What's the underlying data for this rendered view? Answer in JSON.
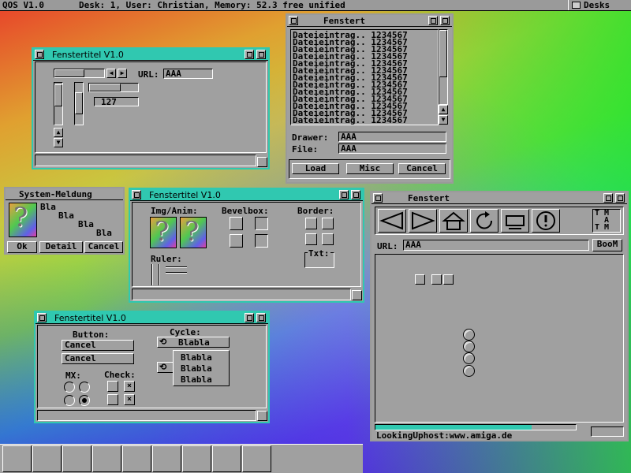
{
  "screen": {
    "title": "QOS V1.0",
    "status": "Desk: 1, User: Christian, Memory: 52.3 free unified",
    "desks_label": "Desks"
  },
  "win1": {
    "title": "Fenstertitel V1.0",
    "url_label": "URL:",
    "url_value": "AAA",
    "number_value": "127"
  },
  "filewin": {
    "title": "Fenstert",
    "entries": [
      "Dateieintrag.. 1234567",
      "Dateieintrag.. 1234567",
      "Dateieintrag.. 1234567",
      "Dateieintrag.. 1234567",
      "Dateieintrag.. 1234567",
      "Dateieintrag.. 1234567",
      "Dateieintrag.. 1234567",
      "Dateieintrag.. 1234567",
      "Dateieintrag.. 1234567",
      "Dateieintrag.. 1234567",
      "Dateieintrag.. 1234567",
      "Dateieintrag.. 1234567",
      "Dateieintrag.. 1234567"
    ],
    "drawer_label": "Drawer:",
    "drawer_value": "AAA",
    "file_label": "File:",
    "file_value": "AAA",
    "load": "Load",
    "misc": "Misc",
    "cancel": "Cancel"
  },
  "sysmsg": {
    "title": "System-Meldung",
    "lines": [
      "Bla",
      "Bla",
      "Bla",
      "Bla"
    ],
    "ok": "Ok",
    "detail": "Detail",
    "cancel": "Cancel"
  },
  "win2": {
    "title": "Fenstertitel V1.0",
    "img_label": "Img/Anim:",
    "bevel_label": "Bevelbox:",
    "border_label": "Border:",
    "ruler_label": "Ruler:",
    "txt_label": "Txt:"
  },
  "browser": {
    "title": "Fenstert",
    "tm": "T M\n  A\nT M",
    "url_label": "URL:",
    "url_value": "AAA",
    "boom": "BooM",
    "status": "LookingUphost:www.amiga.de",
    "progress": 0.78
  },
  "win3": {
    "title": "Fenstertitel V1.0",
    "button_label": "Button:",
    "btn1": "Cancel",
    "btn2": "Cancel",
    "cycle_label": "Cycle:",
    "cycle_value": "Blabla",
    "cycle_options": [
      "Blabla",
      "Blabla",
      "Blabla"
    ],
    "mx_label": "MX:",
    "check_label": "Check:",
    "check_mark": "×"
  }
}
